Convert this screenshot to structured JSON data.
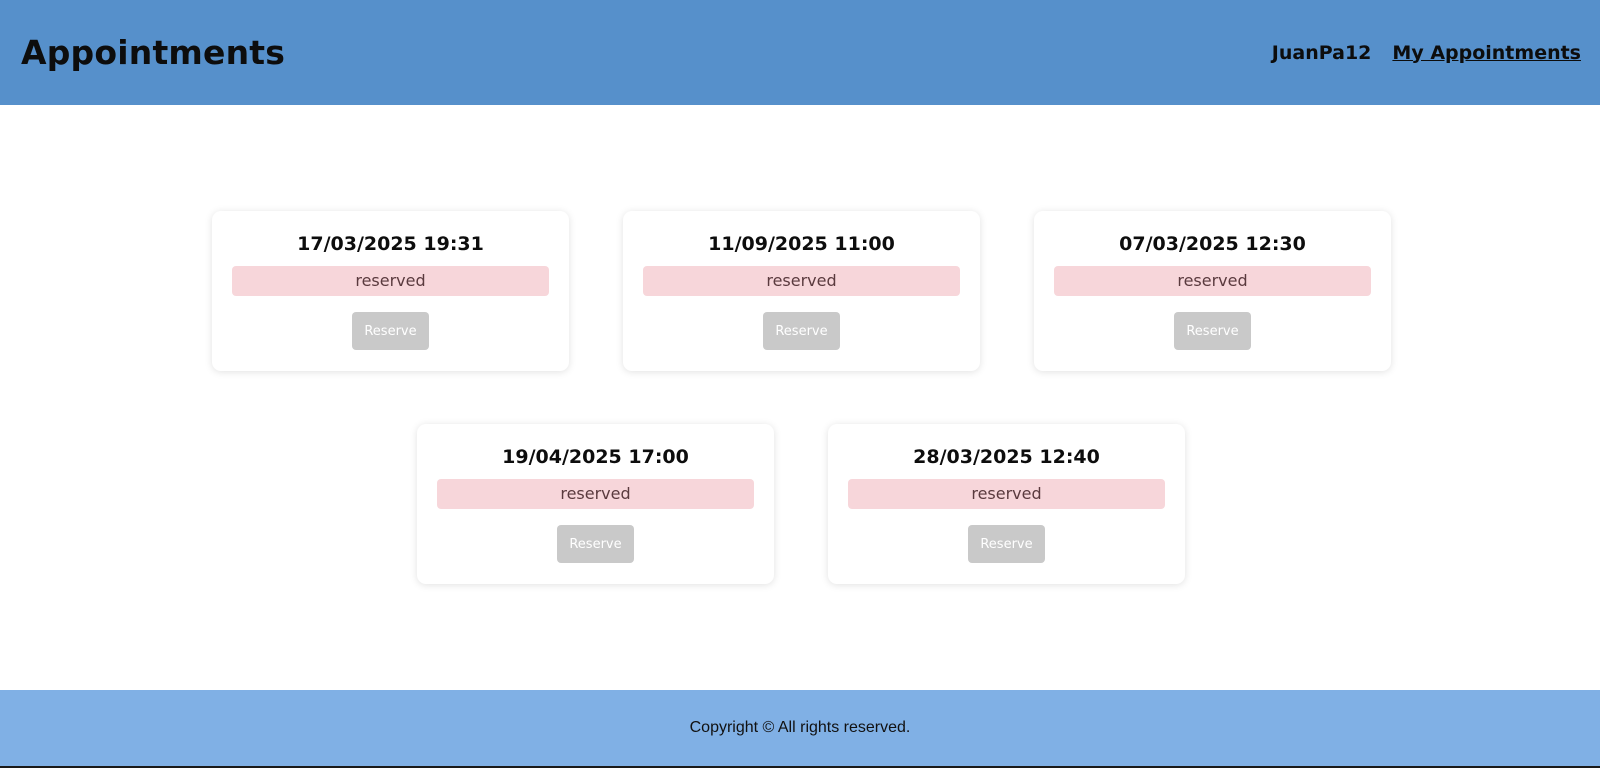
{
  "header": {
    "title": "Appointments",
    "username": "JuanPa12",
    "my_appointments_link": "My Appointments"
  },
  "appointments": [
    {
      "datetime": "17/03/2025 19:31",
      "status": "reserved",
      "button_label": "Reserve"
    },
    {
      "datetime": "11/09/2025 11:00",
      "status": "reserved",
      "button_label": "Reserve"
    },
    {
      "datetime": "07/03/2025 12:30",
      "status": "reserved",
      "button_label": "Reserve"
    },
    {
      "datetime": "19/04/2025 17:00",
      "status": "reserved",
      "button_label": "Reserve"
    },
    {
      "datetime": "28/03/2025 12:40",
      "status": "reserved",
      "button_label": "Reserve"
    }
  ],
  "footer": {
    "copyright": "Copyright © All rights reserved."
  },
  "colors": {
    "header_bg": "#5690cb",
    "footer_bg": "#80b0e5",
    "status_bg": "#f7d6da",
    "button_disabled_bg": "#c9c9c9"
  }
}
